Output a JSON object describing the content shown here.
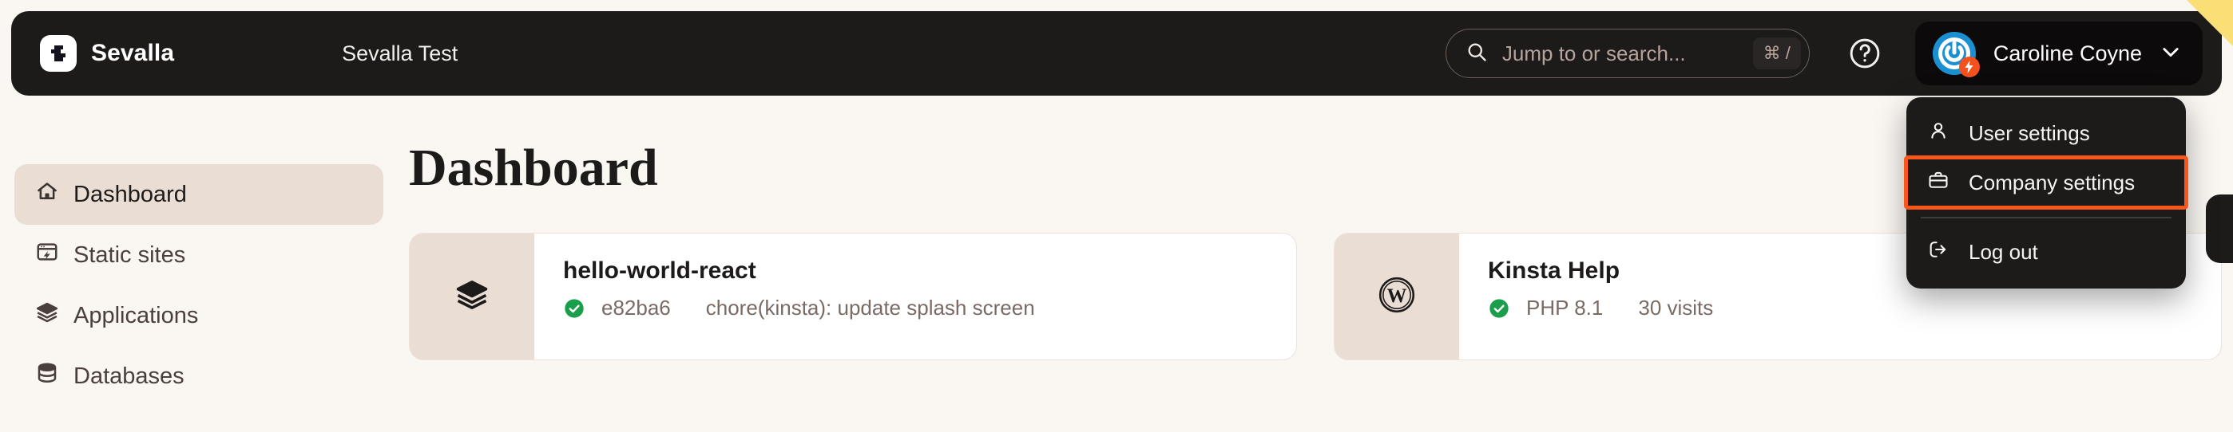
{
  "theme": {
    "dark": "#1d1a1a",
    "page_bg": "#faf6f2",
    "accent_beige": "#eaddd4",
    "highlight_orange": "#f9561b",
    "status_green": "#1a9e4b",
    "corner_yellow": "#fade76"
  },
  "topbar": {
    "brand_name": "Sevalla",
    "brand_icon": "sevalla-logo-icon",
    "breadcrumb": "Sevalla Test",
    "search": {
      "placeholder": "Jump to or search...",
      "shortcut": "⌘ /",
      "icon": "search-icon"
    },
    "help_icon": "question-mark-circle-icon",
    "account": {
      "name": "Caroline Coyne",
      "avatar_icon": "power-avatar-icon",
      "badge_icon": "lightning-bolt-icon",
      "chevron_icon": "chevron-down-icon"
    }
  },
  "account_menu": {
    "items": [
      {
        "label": "User settings",
        "icon": "user-icon",
        "highlighted": false
      },
      {
        "label": "Company settings",
        "icon": "briefcase-icon",
        "highlighted": true
      },
      {
        "label": "Log out",
        "icon": "logout-icon",
        "highlighted": false
      }
    ]
  },
  "sidebar": {
    "items": [
      {
        "label": "Dashboard",
        "icon": "home-icon",
        "active": true
      },
      {
        "label": "Static sites",
        "icon": "browser-lightning-icon",
        "active": false
      },
      {
        "label": "Applications",
        "icon": "layers-icon",
        "active": false
      },
      {
        "label": "Databases",
        "icon": "database-icon",
        "active": false
      }
    ]
  },
  "main": {
    "title": "Dashboard",
    "cards": [
      {
        "title": "hello-world-react",
        "thumb_icon": "layers-icon",
        "status_icon": "check-circle-icon",
        "meta1": "e82ba6",
        "meta2": "chore(kinsta): update splash screen"
      },
      {
        "title": "Kinsta Help",
        "thumb_icon": "wordpress-icon",
        "status_icon": "check-circle-icon",
        "meta1": "PHP 8.1",
        "meta2": "30 visits"
      }
    ]
  }
}
